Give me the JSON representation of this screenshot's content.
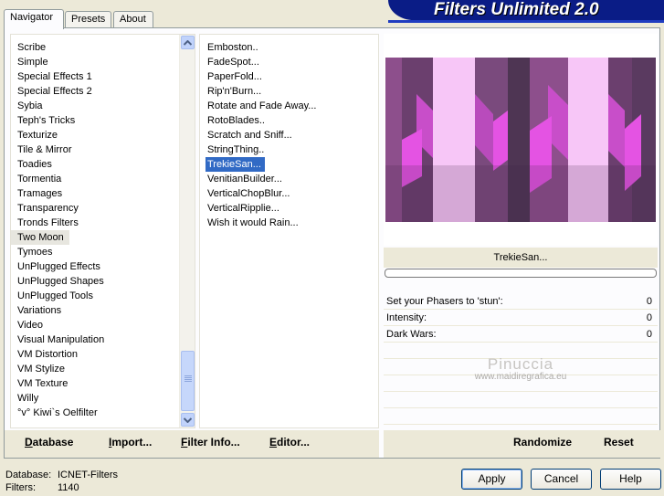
{
  "banner": {
    "title": "Filters Unlimited 2.0"
  },
  "tabs": [
    {
      "label": "Navigator",
      "active": true
    },
    {
      "label": "Presets",
      "active": false
    },
    {
      "label": "About",
      "active": false
    }
  ],
  "categories": {
    "items": [
      "Scribe",
      "Simple",
      "Special Effects 1",
      "Special Effects 2",
      "Sybia",
      "Teph's Tricks",
      "Texturize",
      "Tile & Mirror",
      "Toadies",
      "Tormentia",
      "Tramages",
      "Transparency",
      "Tronds Filters",
      "Two Moon",
      "Tymoes",
      "UnPlugged Effects",
      "UnPlugged Shapes",
      "UnPlugged Tools",
      "Variations",
      "Video",
      "Visual Manipulation",
      "VM Distortion",
      "VM Stylize",
      "VM Texture",
      "Willy",
      "°v° Kiwi`s Oelfilter"
    ],
    "selected": "Two Moon"
  },
  "filters": {
    "items": [
      "Emboston..",
      "FadeSpot...",
      "PaperFold...",
      "Rip'n'Burn...",
      "Rotate and Fade Away...",
      "RotoBlades..",
      "Scratch and Sniff...",
      "StringThing..",
      "TrekieSan...",
      "VenitianBuilder...",
      "VerticalChopBlur...",
      "VerticalRipplie...",
      "Wish it would Rain..."
    ],
    "selected": "TrekieSan..."
  },
  "preview": {
    "filter_name": "TrekieSan...",
    "progress": 0
  },
  "params": [
    {
      "label": "Set your Phasers to 'stun':",
      "value": "0"
    },
    {
      "label": "Intensity:",
      "value": "0"
    },
    {
      "label": "Dark Wars:",
      "value": "0"
    }
  ],
  "watermark": {
    "line1": "Pinuccia",
    "line2": "www.maidiregrafica.eu"
  },
  "bottom_buttons": {
    "database": "Database",
    "import": "Import...",
    "filter_info": "Filter Info...",
    "editor": "Editor...",
    "randomize": "Randomize",
    "reset": "Reset"
  },
  "status": {
    "database_label": "Database:",
    "database_value": "ICNET-Filters",
    "filters_label": "Filters:",
    "filters_value": "1140"
  },
  "dialog_buttons": {
    "apply": "Apply",
    "cancel": "Cancel",
    "help": "Help"
  },
  "colors": {
    "accent_blue": "#316ac5",
    "banner": "#0a1c86",
    "preview_dark": "#5a3a60",
    "preview_light": "#f7c6f7",
    "preview_magenta": "#e453e3"
  }
}
